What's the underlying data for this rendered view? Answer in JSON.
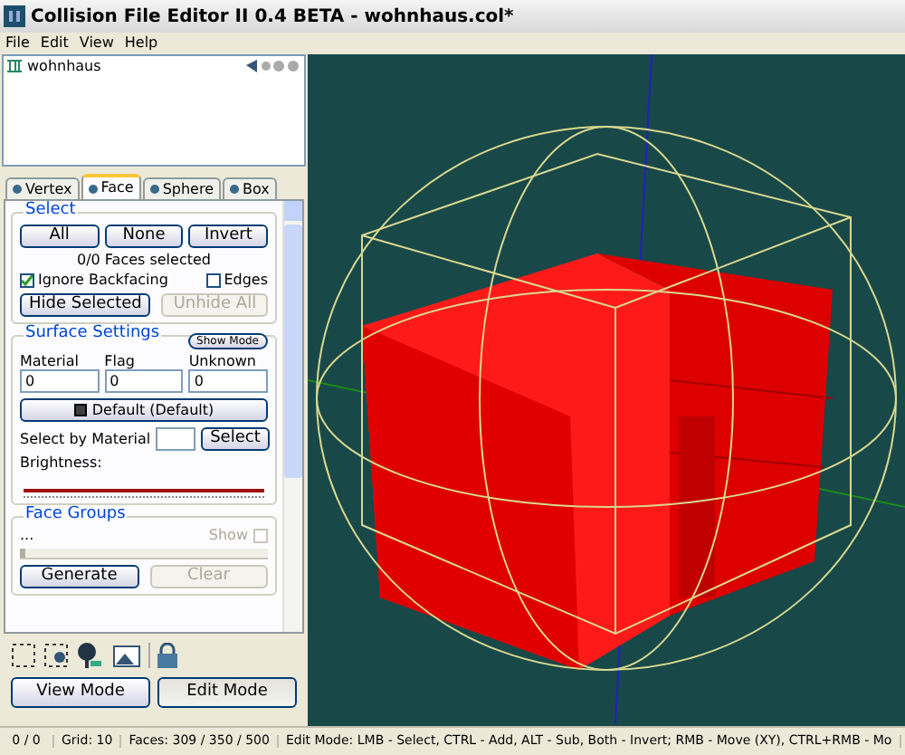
{
  "window": {
    "title": "Collision File Editor II 0.4 BETA - wohnhaus.col*"
  },
  "menu": [
    "File",
    "Edit",
    "View",
    "Help"
  ],
  "tree": {
    "items": [
      {
        "label": "wohnhaus",
        "selected": false
      }
    ]
  },
  "tabs": [
    {
      "label": "Vertex",
      "selected": false
    },
    {
      "label": "Face",
      "selected": true
    },
    {
      "label": "Sphere",
      "selected": false
    },
    {
      "label": "Box",
      "selected": false
    }
  ],
  "select_group": {
    "title": "Select",
    "buttons": [
      "All",
      "None",
      "Invert"
    ],
    "info": "0/0 Faces selected",
    "options": [
      {
        "label": "Ignore Backfacing",
        "checked": true
      },
      {
        "label": "Edges",
        "checked": false
      }
    ],
    "actions": [
      {
        "label": "Hide Selected",
        "disabled": false
      },
      {
        "label": "Unhide All",
        "disabled": true
      }
    ]
  },
  "surface": {
    "title": "Surface Settings",
    "mode_button": "Show Mode",
    "fields": [
      {
        "label": "Material",
        "value": "0"
      },
      {
        "label": "Flag",
        "value": "0"
      },
      {
        "label": "Unknown",
        "value": "0"
      }
    ],
    "material_button": "Default (Default)",
    "select_label": "Select by Material",
    "select_button": "Select",
    "brightness_label": "Brightness:",
    "brightness": {
      "level": 1.0
    }
  },
  "face_groups": {
    "title": "Face Groups",
    "item": "...",
    "show_label": "Show",
    "show_checked": false,
    "slider": {
      "level": 0.0
    },
    "actions": [
      {
        "label": "Generate",
        "disabled": false
      },
      {
        "label": "Clear",
        "disabled": true
      }
    ]
  },
  "mode_buttons": [
    {
      "label": "View Mode",
      "selected": false
    },
    {
      "label": "Edit Mode",
      "selected": true
    }
  ],
  "status_bar": [
    "0 / 0",
    "Grid: 10",
    "Faces: 309 / 350 / 500",
    "Edit Mode: LMB - Select, CTRL - Add, ALT - Sub, Both - Invert; RMB - Move (XY), CTRL+RMB - Mo"
  ]
}
